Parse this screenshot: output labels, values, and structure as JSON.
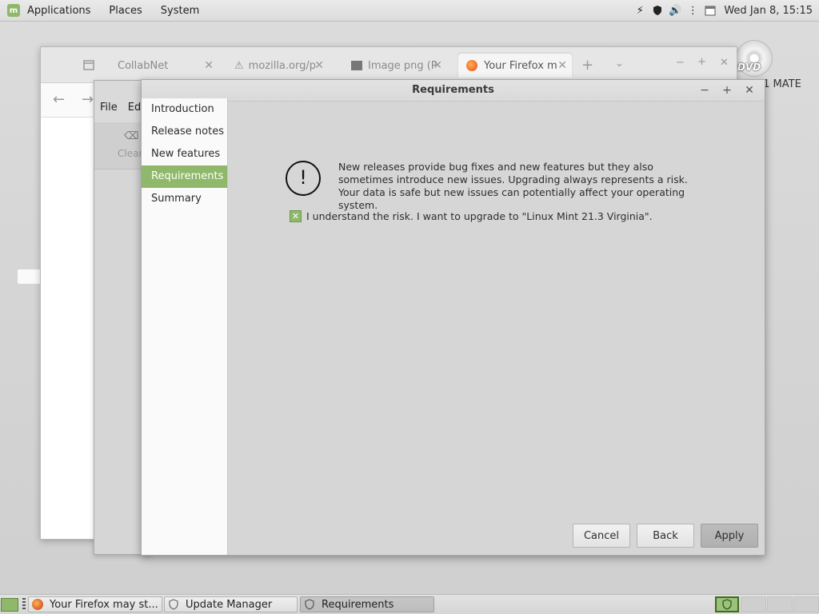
{
  "top_panel": {
    "menu": [
      "Applications",
      "Places",
      "System"
    ],
    "clock": "Wed Jan  8, 15:15"
  },
  "desktop": {
    "dvd_label": "DVD",
    "mate_fragment": ".1 MATE"
  },
  "firefox": {
    "tabs": [
      {
        "label": "CollabNet"
      },
      {
        "label": "mozilla.org/p"
      },
      {
        "label": "Image png (P"
      },
      {
        "label": "Your Firefox m"
      }
    ]
  },
  "update_manager": {
    "menu": [
      "File",
      "Ed"
    ],
    "toolbar_fragment": "Clear"
  },
  "dialog": {
    "title": "Requirements",
    "sidebar": [
      "Introduction",
      "Release notes",
      "New features",
      "Requirements",
      "Summary"
    ],
    "selected": "Requirements",
    "warning_text": "New releases provide bug fixes and new features but they also sometimes introduce new issues. Upgrading always represents a risk. Your data is safe but new issues can potentially affect your operating system.",
    "checkbox_label": "I understand the risk. I want to upgrade to \"Linux Mint 21.3 Virginia\".",
    "checkbox_checked": true,
    "buttons": {
      "cancel": "Cancel",
      "back": "Back",
      "apply": "Apply"
    }
  },
  "taskbar": {
    "tasks": [
      {
        "label": "Your Firefox may st..."
      },
      {
        "label": "Update Manager"
      },
      {
        "label": "Requirements"
      }
    ]
  },
  "colors": {
    "accent": "#8fb86a"
  }
}
